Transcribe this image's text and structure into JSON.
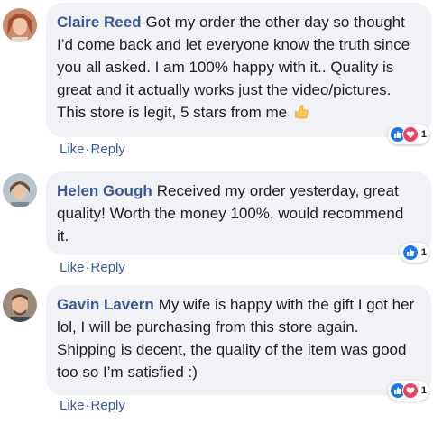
{
  "comments": [
    {
      "name": "Claire Reed",
      "text": "Got my order the other day so thought I’d come back and let everyone know the truth since you all asked. I am 100% happy with it.. Quality is great and it actually works just the video/pictures. This store is legit, 5 stars from me",
      "emoji": "thumbs-up-emoji",
      "reactions": [
        "like-icon",
        "love-icon"
      ],
      "reaction_count": "1",
      "like_label": "Like",
      "reply_label": "Reply",
      "separator": "·"
    },
    {
      "name": "Helen Gough",
      "text": "Received my order yesterday, great quality! Worth the money 100%, would recommend it.",
      "reactions": [
        "like-icon"
      ],
      "reaction_count": "1",
      "like_label": "Like",
      "reply_label": "Reply",
      "separator": "·"
    },
    {
      "name": "Gavin Lavern",
      "text": "My wife is happy with the gift I got her lol, I will be purchasing from this store again. Shipping is decent, the quality of the item was good too so I’m satisfied :)",
      "reactions": [
        "like-icon",
        "love-icon"
      ],
      "reaction_count": "1",
      "like_label": "Like",
      "reply_label": "Reply",
      "separator": "·"
    }
  ],
  "colors": {
    "name": "#385898",
    "bubble": "#f0f2f5",
    "like": "#1877f2",
    "love": "#f33e58"
  }
}
